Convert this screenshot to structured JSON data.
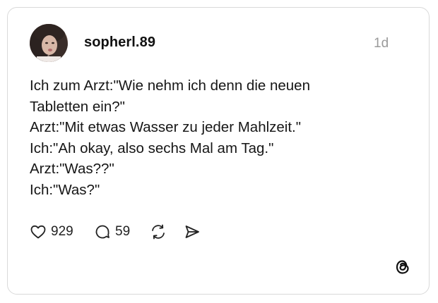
{
  "post": {
    "username": "sopherl.89",
    "time": "1d",
    "lines": [
      "Ich zum Arzt:\"Wie nehm ich denn die neuen",
      "Tabletten ein?\"",
      "Arzt:\"Mit etwas Wasser zu jeder Mahlzeit.\"",
      "Ich:\"Ah okay, also sechs Mal am Tag.\"",
      "Arzt:\"Was??\"",
      "Ich:\"Was?\""
    ]
  },
  "actions": {
    "like_count": "929",
    "reply_count": "59"
  },
  "icons": {
    "like": "heart-icon",
    "reply": "speech-bubble-icon",
    "repost": "repost-icon",
    "share": "send-icon",
    "brand": "threads-logo-icon"
  },
  "colors": {
    "text": "#161616",
    "muted": "#9a9a9a",
    "border": "#d9d9d9"
  }
}
